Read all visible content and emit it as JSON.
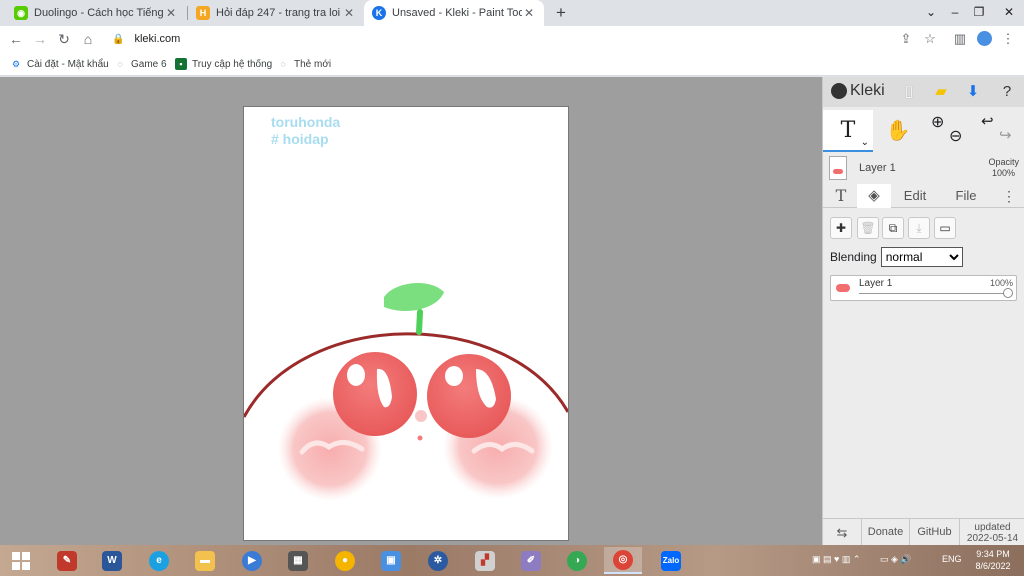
{
  "tabs": [
    {
      "title": "Duolingo - Cách học Tiếng Anh t",
      "icon": "duolingo-icon",
      "color": "#58cc02"
    },
    {
      "title": "Hỏi đáp 247 - trang tra loi",
      "icon": "hoidap-icon",
      "color": "#f5a623"
    },
    {
      "title": "Unsaved - Kleki - Paint Tool",
      "icon": "kleki-icon",
      "color": "#1a73e8"
    }
  ],
  "address": {
    "url": "kleki.com"
  },
  "bookmarks": [
    {
      "label": "Cài đặt - Mật khẩu",
      "icon": "gear-icon"
    },
    {
      "label": "Game 6",
      "icon": "globe-icon"
    },
    {
      "label": "Truy cập hệ thống",
      "icon": "system-icon"
    },
    {
      "label": "Thẻ mới",
      "icon": "globe-icon"
    }
  ],
  "canvas": {
    "line1": "toruhonda",
    "line2": "# hoidap"
  },
  "panel": {
    "brand": "Kleki",
    "layer_name": "Layer 1",
    "opacity_label": "Opacity",
    "opacity_value": "100%",
    "tabs": {
      "edit": "Edit",
      "file": "File"
    },
    "blending_label": "Blending",
    "blending_value": "normal",
    "layer_item": {
      "name": "Layer 1",
      "opacity": "100%"
    },
    "footer": {
      "donate": "Donate",
      "github": "GitHub",
      "updated_label": "updated",
      "updated_date": "2022-05-14"
    }
  },
  "tray": {
    "lang": "ENG",
    "time": "9:34 PM",
    "date": "8/6/2022"
  },
  "colors": {
    "accent": "#3a8fde",
    "outline": "#9b2a2a",
    "cherry": "#f26d6d",
    "leaf": "#6ddb72",
    "blush": "#f7b3b3"
  }
}
